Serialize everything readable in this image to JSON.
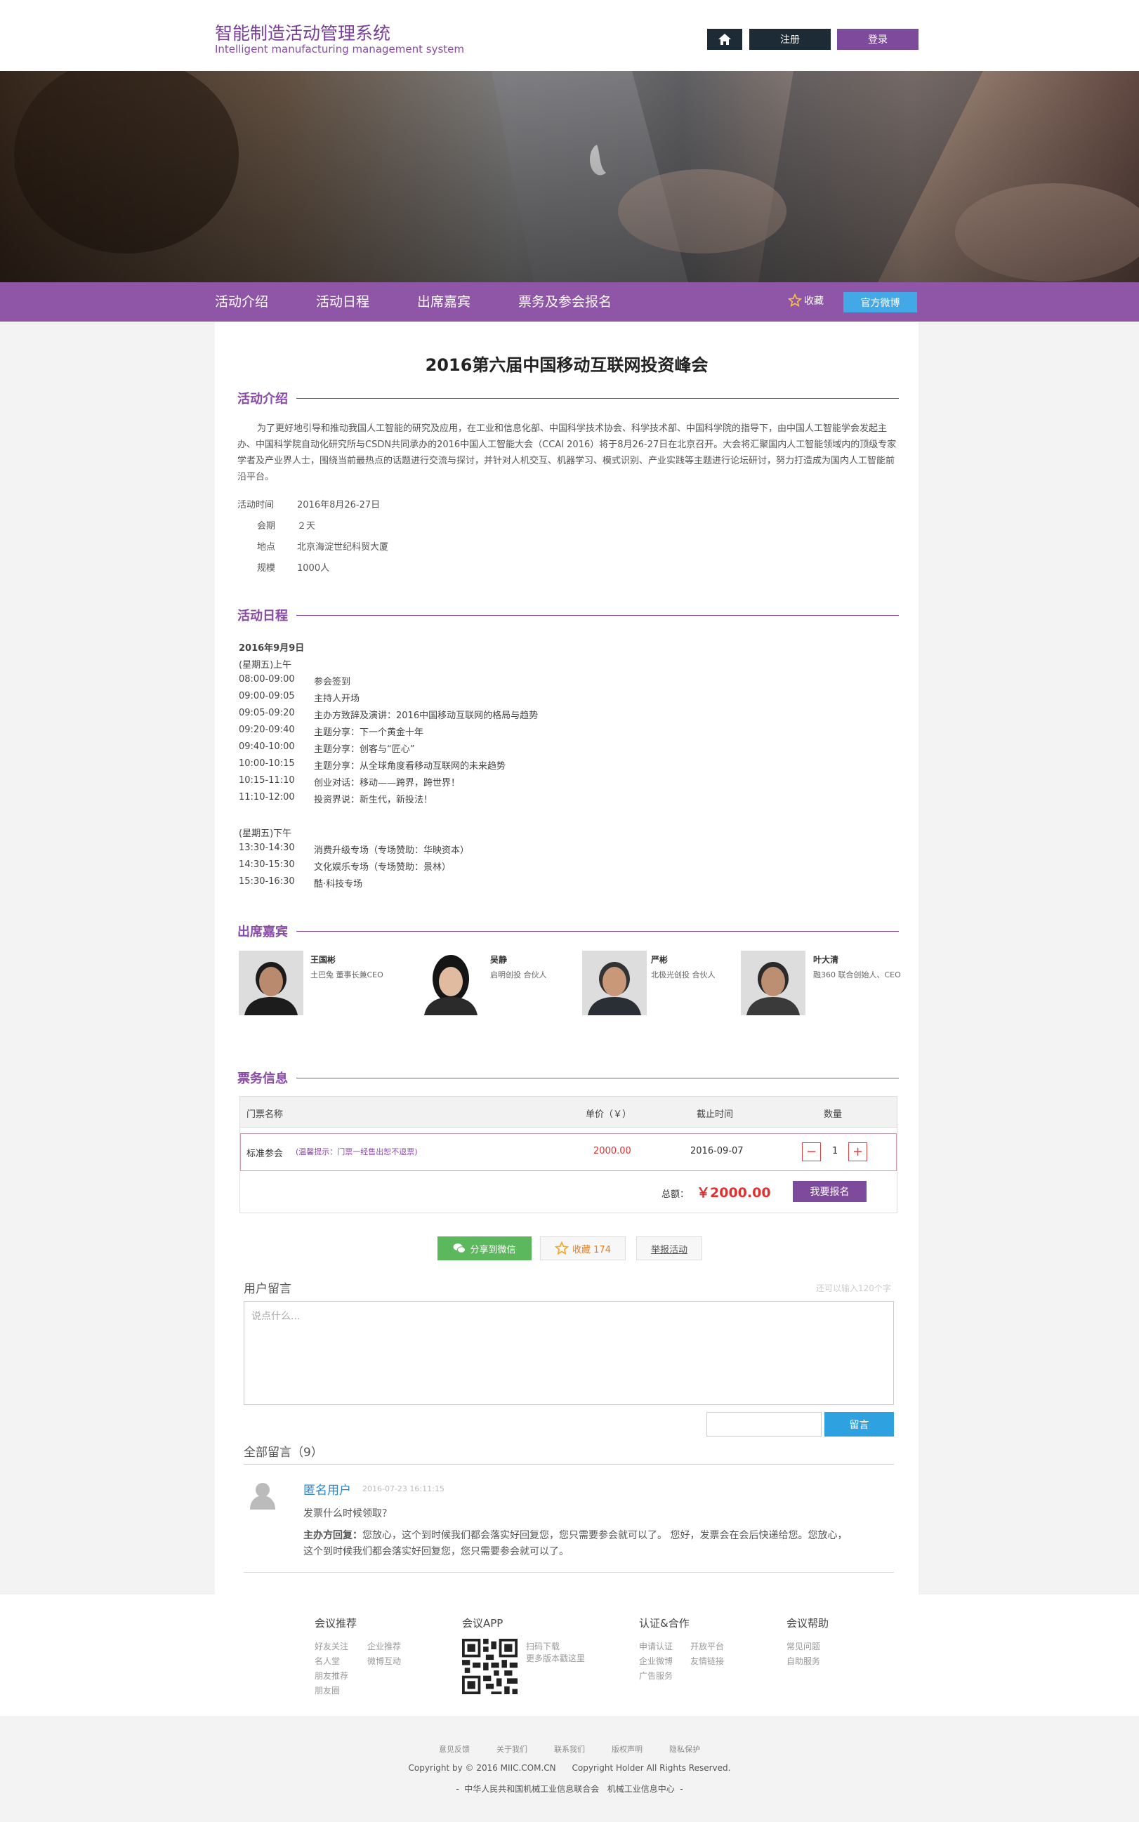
{
  "header": {
    "title_cn": "智能制造活动管理系统",
    "title_en": "Intelligent manufacturing management system",
    "register": "注册",
    "login": "登录"
  },
  "nav": {
    "items": [
      "活动介绍",
      "活动日程",
      "出席嘉宾",
      "票务及参会报名"
    ],
    "favorite": "收藏",
    "weibo": "官方微博"
  },
  "event": {
    "title": "2016第六届中国移动互联网投资峰会"
  },
  "intro": {
    "heading": "活动介绍",
    "paragraph": "为了更好地引导和推动我国人工智能的研究及应用，在工业和信息化部、中国科学技术协会、科学技术部、中国科学院的指导下，由中国人工智能学会发起主办、中国科学院自动化研究所与CSDN共同承办的2016中国人工智能大会（CCAI 2016）将于8月26-27日在北京召开。大会将汇聚国内人工智能领域内的顶级专家学者及产业界人士，围绕当前最热点的话题进行交流与探讨，并针对人机交互、机器学习、模式识别、产业实践等主题进行论坛研讨，努力打造成为国内人工智能前沿平台。",
    "details": [
      {
        "label": "活动时间",
        "value": "2016年8月26-27日"
      },
      {
        "label": "会期",
        "value": "２天"
      },
      {
        "label": "地点",
        "value": "北京海淀世纪科贸大厦"
      },
      {
        "label": "规模",
        "value": "1000人"
      }
    ]
  },
  "schedule": {
    "heading": "活动日程",
    "date": "2016年9月9日",
    "am_label": "(星期五)上午",
    "am": [
      [
        "08:00-09:00",
        "参会签到"
      ],
      [
        "09:00-09:05",
        "主持人开场"
      ],
      [
        "09:05-09:20",
        "主办方致辞及演讲：2016中国移动互联网的格局与趋势"
      ],
      [
        "09:20-09:40",
        "主题分享：下一个黄金十年"
      ],
      [
        "09:40-10:00",
        "主题分享：创客与“匠心”"
      ],
      [
        "10:00-10:15",
        "主题分享：从全球角度看移动互联网的未来趋势"
      ],
      [
        "10:15-11:10",
        "创业对话：移动——跨界，跨世界！"
      ],
      [
        "11:10-12:00",
        "投资界说：新生代，新投法！"
      ]
    ],
    "pm_label": "(星期五)下午",
    "pm": [
      [
        "13:30-14:30",
        "消费升级专场（专场赞助：华映资本）"
      ],
      [
        "14:30-15:30",
        "文化娱乐专场（专场赞助：景林）"
      ],
      [
        "15:30-16:30",
        "酷·科技专场"
      ]
    ]
  },
  "guests": {
    "heading": "出席嘉宾",
    "items": [
      {
        "name": "王国彬",
        "role": "土巴兔 董事长兼CEO"
      },
      {
        "name": "吴静",
        "role": "启明创投 合伙人"
      },
      {
        "name": "严彬",
        "role": "北极光创投 合伙人"
      },
      {
        "name": "叶大清",
        "role": "融360 联合创始人、CEO"
      }
    ]
  },
  "tickets": {
    "heading": "票务信息",
    "cols": [
      "门票名称",
      "单价（￥）",
      "截止时间",
      "数量"
    ],
    "row": {
      "name": "标准参会",
      "tip": "(温馨提示：门票一经售出恕不退票)",
      "price": "2000.00",
      "deadline": "2016-09-07",
      "qty": "1"
    },
    "total_label": "总额：",
    "total": "￥2000.00",
    "signup": "我要报名"
  },
  "actions": {
    "share": "分享到微信",
    "fav": "收藏 174",
    "report": "举报活动"
  },
  "comments": {
    "heading": "用户留言",
    "limit": "还可以输入120个字",
    "placeholder": "说点什么...",
    "submit": "留言",
    "all": "全部留言（9）",
    "item": {
      "user": "匿名用户",
      "time": "2016-07-23 16:11:15",
      "question": "发票什么时候领取？",
      "reply_label": "主办方回复：",
      "reply": "您放心，这个到时候我们都会落实好回复您，您只需要参会就可以了。 您好，发票会在会后快递给您。您放心，这个到时候我们都会落实好回复您，您只需要参会就可以了。"
    }
  },
  "footer": {
    "cols": [
      {
        "title": "会议推荐",
        "links": [
          "好友关注",
          "企业推荐",
          "名人堂",
          "微博互动",
          "朋友推荐",
          "朋友圈"
        ]
      },
      {
        "title": "会议APP",
        "links": [
          "扫码下载",
          "更多版本戳这里"
        ]
      },
      {
        "title": "认证&合作",
        "links": [
          "申请认证",
          "开放平台",
          "企业微博",
          "友情链接",
          "广告服务"
        ]
      },
      {
        "title": "会议帮助",
        "links": [
          "常见问题",
          "自助服务"
        ]
      }
    ],
    "bottom_links": [
      "意见反馈",
      "关于我们",
      "联系我们",
      "版权声明",
      "隐私保护"
    ],
    "copyright": "Copyright by © 2016 MIIC.COM.CN      Copyright Holder All Rights Reserved.",
    "org": "-  中华人民共和国机械工业信息联合会   机械工业信息中心  -"
  },
  "colors": {
    "accent": "#8a4aa8",
    "nav": "#8f55a6",
    "dark": "#1d2b36",
    "blue": "#43a9e6",
    "red": "#e03030",
    "green": "#5cb85c"
  }
}
